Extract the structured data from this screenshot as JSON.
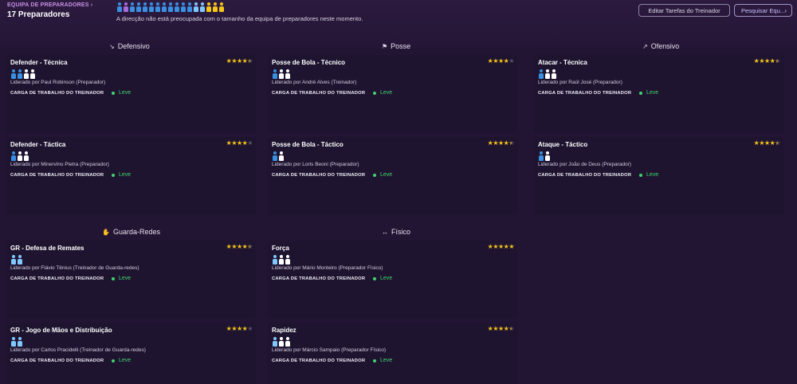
{
  "header": {
    "breadcrumb": "EQUIPA DE PREPARADORES",
    "title": "17 Preparadores",
    "message": "A direcção não está preocupada com o tamanho da equipa de preparadores neste momento.",
    "edit_button": "Editar Tarefas do Treinador",
    "search_button": "Pesquisar Equ...",
    "staff_colors": [
      "#3a8fe0",
      "#a86cd8",
      "#3a8fe0",
      "#3a8fe0",
      "#3a8fe0",
      "#3a8fe0",
      "#3a8fe0",
      "#3a8fe0",
      "#3a8fe0",
      "#3a8fe0",
      "#3a8fe0",
      "#3a8fe0",
      "#80c8ff",
      "#80c8ff",
      "#f5c518",
      "#f5c518",
      "#f5c518"
    ]
  },
  "sections": {
    "defensivo": "Defensivo",
    "posse": "Posse",
    "ofensivo": "Ofensivo",
    "guarda_redes": "Guarda-Redes",
    "fisico": "Físico"
  },
  "colors": {
    "accent": "#c890e6",
    "star": "#f5c518",
    "load": "#3fd46b"
  },
  "load_label": "CARGA DE TRABALHO DO TREINADOR",
  "cards": [
    {
      "title": "Defender - Técnica",
      "stars": 4.5,
      "lead": "Liderado por Paul Robinson (Preparador)",
      "load": "Leve",
      "people": [
        "#3a8fe0",
        "#3a8fe0",
        "#ffffff",
        "#ffffff"
      ]
    },
    {
      "title": "Posse de Bola - Técnico",
      "stars": 4,
      "lead": "Liderado por André Alves (Treinador)",
      "load": "Leve",
      "people": [
        "#3a8fe0",
        "#ffffff",
        "#ffffff"
      ]
    },
    {
      "title": "Atacar - Técnica",
      "stars": 4.5,
      "lead": "Liderado por Raúl José (Preparador)",
      "load": "Leve",
      "people": [
        "#3a8fe0",
        "#ffffff",
        "#ffffff"
      ]
    },
    {
      "title": "Defender - Táctica",
      "stars": 4,
      "lead": "Liderado por Minervino Pietra (Preparador)",
      "load": "Leve",
      "people": [
        "#3a8fe0",
        "#ffffff",
        "#ffffff"
      ]
    },
    {
      "title": "Posse de Bola - Táctico",
      "stars": 4.5,
      "lead": "Liderado por Loris Beoni (Preparador)",
      "load": "Leve",
      "people": [
        "#3a8fe0",
        "#ffffff"
      ]
    },
    {
      "title": "Ataque - Táctico",
      "stars": 4.5,
      "lead": "Liderado por João de Deus (Preparador)",
      "load": "Leve",
      "people": [
        "#3a8fe0",
        "#ffffff"
      ]
    },
    {
      "title": "GR - Defesa de Remates",
      "stars": 4.5,
      "lead": "Liderado por Flávio Tênius (Treinador de Guarda-redes)",
      "load": "Leve",
      "people": [
        "#80c8ff",
        "#80c8ff"
      ]
    },
    {
      "title": "Força",
      "stars": 5,
      "lead": "Liderado por Mário Monteiro (Preparador Físico)",
      "load": "Leve",
      "people": [
        "#80c8ff",
        "#ffffff",
        "#ffffff"
      ]
    },
    {
      "title": "GR - Jogo de Mãos e Distribuição",
      "stars": 4,
      "lead": "Liderado por Carlos Pracidelli (Treinador de Guarda-redes)",
      "load": "Leve",
      "people": [
        "#80c8ff",
        "#80c8ff"
      ]
    },
    {
      "title": "Rapidez",
      "stars": 4.5,
      "lead": "Liderado por Márcio Sampaio (Preparador Físico)",
      "load": "Leve",
      "people": [
        "#80c8ff",
        "#ffffff",
        "#ffffff"
      ]
    }
  ]
}
